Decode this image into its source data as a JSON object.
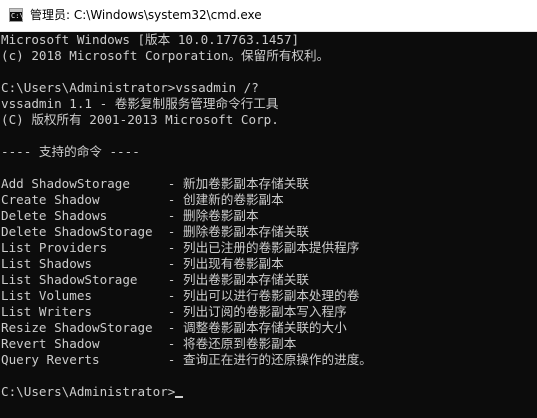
{
  "window": {
    "title": "管理员: C:\\Windows\\system32\\cmd.exe",
    "icon": "cmd-icon"
  },
  "console": {
    "lines": [
      "Microsoft Windows [版本 10.0.17763.1457]",
      "(c) 2018 Microsoft Corporation。保留所有权利。",
      "",
      "C:\\Users\\Administrator>vssadmin /?",
      "vssadmin 1.1 - 卷影复制服务管理命令行工具",
      "(C) 版权所有 2001-2013 Microsoft Corp.",
      "",
      "---- 支持的命令 ----",
      "",
      "Add ShadowStorage     - 新加卷影副本存储关联",
      "Create Shadow         - 创建新的卷影副本",
      "Delete Shadows        - 删除卷影副本",
      "Delete ShadowStorage  - 删除卷影副本存储关联",
      "List Providers        - 列出已注册的卷影副本提供程序",
      "List Shadows          - 列出现有卷影副本",
      "List ShadowStorage    - 列出卷影副本存储关联",
      "List Volumes          - 列出可以进行卷影副本处理的卷",
      "List Writers          - 列出订阅的卷影副本写入程序",
      "Resize ShadowStorage  - 调整卷影副本存储关联的大小",
      "Revert Shadow         - 将卷还原到卷影副本",
      "Query Reverts         - 查询正在进行的还原操作的进度。",
      "",
      "C:\\Users\\Administrator>"
    ]
  },
  "colors": {
    "console_background": "#0c0c0c",
    "console_text": "#cccccc",
    "titlebar_background": "#ffffff"
  }
}
